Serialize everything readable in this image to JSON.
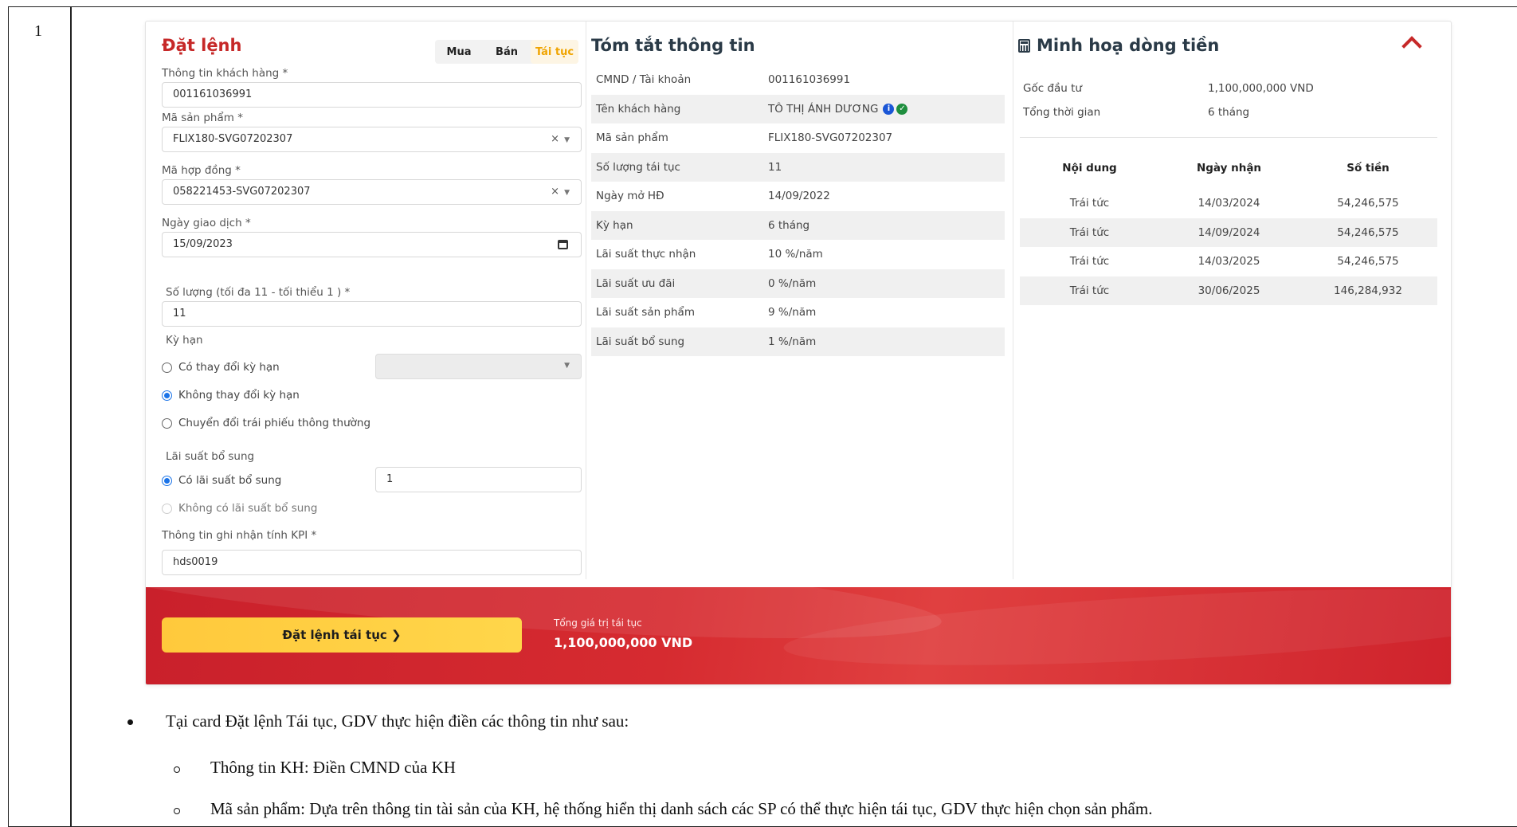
{
  "document": {
    "row_number": "1",
    "bullet_main": "Tại card Đặt lệnh Tái tục, GDV thực hiện điền các thông tin như sau:",
    "sub_bullets": [
      "Thông tin KH: Điền CMND của KH",
      "Mã sản phẩm: Dựa trên thông tin tài sản của KH, hệ thống hiển thị danh sách các SP có thể thực hiện tái tục, GDV thực hiện chọn sản phẩm."
    ]
  },
  "order": {
    "title": "Đặt lệnh",
    "tabs": [
      "Mua",
      "Bán",
      "Tái tục"
    ],
    "active_tab": "Tái tục",
    "customer_label": "Thông tin khách hàng *",
    "customer_value": "001161036991",
    "product_label": "Mã sản phẩm *",
    "product_value": "FLIX180-SVG07202307",
    "contract_label": "Mã hợp đồng *",
    "contract_value": "058221453-SVG07202307",
    "date_label": "Ngày giao dịch *",
    "date_value": "15/09/2023",
    "qty_label": "Số lượng (tối đa 11 - tối thiểu 1 ) *",
    "qty_value": "11",
    "term_label": "Kỳ hạn",
    "term_options": [
      "Có thay đổi kỳ hạn",
      "Không thay đổi kỳ hạn",
      "Chuyển đổi trái phiếu thông thường"
    ],
    "term_selected": 1,
    "extra_label": "Lãi suất bổ sung",
    "extra_options": [
      "Có lãi suất bổ sung",
      "Không có lãi suất bổ sung"
    ],
    "extra_selected": 0,
    "extra_value": "1",
    "kpi_label": "Thông tin ghi nhận tính KPI *",
    "kpi_value": "hds0019",
    "clear_icon": "×",
    "submit_label": "Đặt lệnh tái tục ❯",
    "total_label": "Tổng giá trị tái tục",
    "total_value": "1,100,000,000 VND"
  },
  "summary": {
    "title": "Tóm tắt thông tin",
    "rows": [
      {
        "k": "CMND / Tài khoản",
        "v": "001161036991"
      },
      {
        "k": "Tên khách hàng",
        "v": "TÔ THỊ ÁNH DƯƠNG"
      },
      {
        "k": "Mã sản phẩm",
        "v": "FLIX180-SVG07202307"
      },
      {
        "k": "Số lượng tái tục",
        "v": "11"
      },
      {
        "k": "Ngày mở HĐ",
        "v": "14/09/2022"
      },
      {
        "k": "Kỳ hạn",
        "v": "6 tháng"
      },
      {
        "k": "Lãi suất thực nhận",
        "v": "10 %/năm"
      },
      {
        "k": "Lãi suất ưu đãi",
        "v": "0 %/năm"
      },
      {
        "k": "Lãi suất sản phẩm",
        "v": "9 %/năm"
      },
      {
        "k": "Lãi suất bổ sung",
        "v": "1 %/năm"
      }
    ]
  },
  "cashflow": {
    "title": "Minh hoạ dòng tiền",
    "principal_label": "Gốc đầu tư",
    "principal_value": "1,100,000,000 VND",
    "duration_label": "Tổng thời gian",
    "duration_value": "6 tháng",
    "headers": [
      "Nội dung",
      "Ngày nhận",
      "Số tiền"
    ],
    "rows": [
      {
        "content": "Trái tức",
        "date": "14/03/2024",
        "amount": "54,246,575"
      },
      {
        "content": "Trái tức",
        "date": "14/09/2024",
        "amount": "54,246,575"
      },
      {
        "content": "Trái tức",
        "date": "14/03/2025",
        "amount": "54,246,575"
      },
      {
        "content": "Trái tức",
        "date": "30/06/2025",
        "amount": "146,284,932"
      }
    ]
  },
  "colors": {
    "brand_red": "#c62828",
    "accent_yellow": "#ffc93c",
    "active_tab": "#f0a400",
    "radio_blue": "#1a73e8"
  }
}
